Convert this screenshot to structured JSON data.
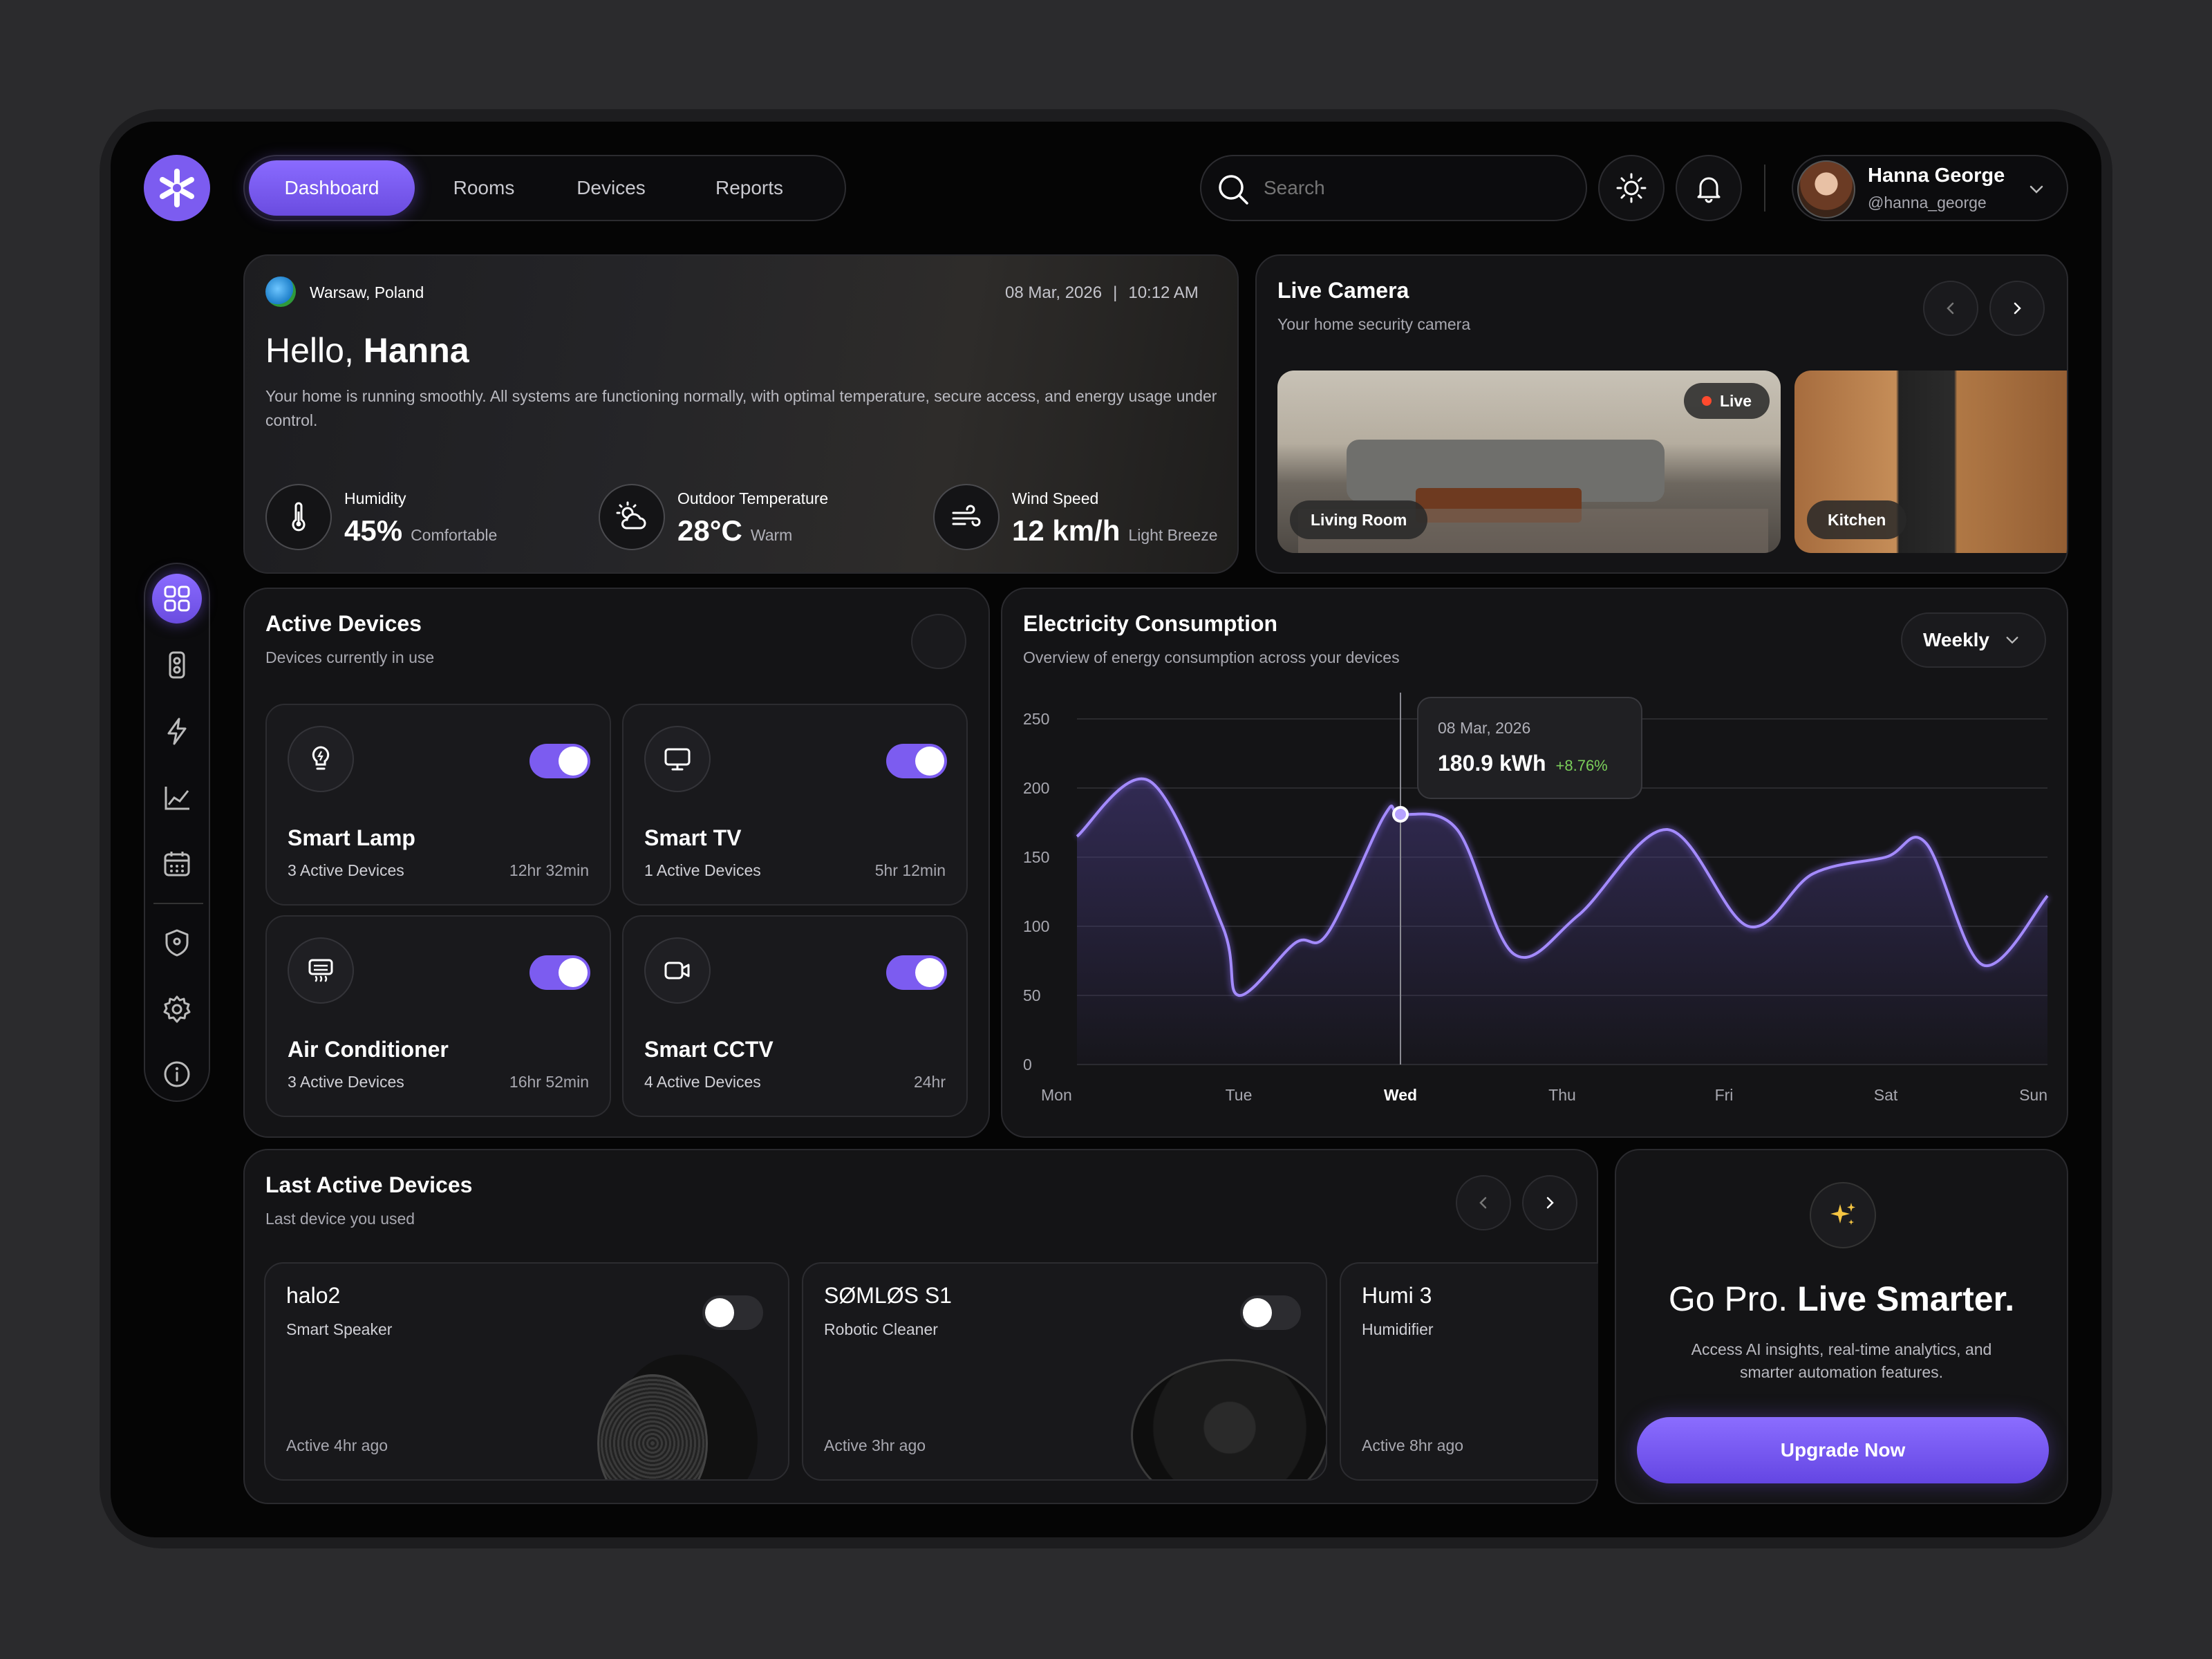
{
  "nav": {
    "tabs": [
      "Dashboard",
      "Rooms",
      "Devices",
      "Reports"
    ],
    "active": "Dashboard"
  },
  "search": {
    "placeholder": "Search"
  },
  "user": {
    "name": "Hanna George",
    "handle": "@hanna_george"
  },
  "hero": {
    "location": "Warsaw, Poland",
    "date": "08 Mar, 2026",
    "time": "10:12 AM",
    "greeting": "Hello,",
    "name": "Hanna",
    "description": "Your home is running smoothly. All systems are functioning normally, with optimal temperature, secure access, and energy usage under control.",
    "stats": [
      {
        "label": "Humidity",
        "value": "45%",
        "note": "Comfortable",
        "icon": "thermometer-icon"
      },
      {
        "label": "Outdoor Temperature",
        "value": "28°C",
        "note": "Warm",
        "icon": "sun-cloud-icon"
      },
      {
        "label": "Wind Speed",
        "value": "12 km/h",
        "note": "Light Breeze",
        "icon": "wind-icon"
      }
    ]
  },
  "camera": {
    "title": "Live Camera",
    "subtitle": "Your home security camera",
    "live_label": "Live",
    "rooms": [
      "Living Room",
      "Kitchen"
    ]
  },
  "active_devices": {
    "title": "Active Devices",
    "subtitle": "Devices currently in use",
    "devices": [
      {
        "name": "Smart Lamp",
        "count": "3 Active Devices",
        "time": "12hr 32min",
        "on": true,
        "icon": "lamp-icon"
      },
      {
        "name": "Smart TV",
        "count": "1 Active Devices",
        "time": "5hr 12min",
        "on": true,
        "icon": "tv-icon"
      },
      {
        "name": "Air Conditioner",
        "count": "3 Active Devices",
        "time": "16hr 52min",
        "on": true,
        "icon": "air-conditioner-icon"
      },
      {
        "name": "Smart CCTV",
        "count": "4 Active Devices",
        "time": "24hr",
        "on": true,
        "icon": "cctv-icon"
      }
    ]
  },
  "electricity": {
    "title": "Electricity Consumption",
    "subtitle": "Overview of energy consumption across your devices",
    "period": "Weekly",
    "tooltip": {
      "date": "08 Mar, 2026",
      "value": "180.9 kWh",
      "change": "+8.76%"
    }
  },
  "chart_data": {
    "type": "area",
    "title": "Electricity Consumption",
    "x": [
      "Mon",
      "Tue",
      "Wed",
      "Thu",
      "Fri",
      "Sat",
      "Sun"
    ],
    "highlight_x": "Wed",
    "yticks": [
      250,
      200,
      150,
      100,
      50,
      0
    ],
    "ylim": [
      0,
      250
    ],
    "grid": true,
    "series": [
      {
        "points": [
          [
            0,
            165
          ],
          [
            0.45,
            205
          ],
          [
            0.9,
            100
          ],
          [
            1.0,
            50
          ],
          [
            1.35,
            88
          ],
          [
            1.55,
            95
          ],
          [
            1.9,
            180
          ],
          [
            2.0,
            181
          ],
          [
            2.35,
            170
          ],
          [
            2.7,
            80
          ],
          [
            3.1,
            108
          ],
          [
            3.65,
            170
          ],
          [
            4.15,
            100
          ],
          [
            4.55,
            138
          ],
          [
            5.0,
            150
          ],
          [
            5.25,
            160
          ],
          [
            5.6,
            72
          ],
          [
            6.0,
            122
          ]
        ]
      }
    ],
    "colors": {
      "line": "#a48bff",
      "fill": "#3a2f6a"
    }
  },
  "last_active": {
    "title": "Last Active Devices",
    "subtitle": "Last device you used",
    "items": [
      {
        "name": "halo2",
        "type": "Smart Speaker",
        "status": "Active 4hr ago"
      },
      {
        "name": "SØMLØS S1",
        "type": "Robotic Cleaner",
        "status": "Active 3hr ago"
      },
      {
        "name": "Humi 3",
        "type": "Humidifier",
        "status": "Active 8hr ago"
      }
    ]
  },
  "promo": {
    "title_light": "Go Pro.",
    "title_bold": "Live Smarter.",
    "description": "Access AI insights, real-time analytics, and smarter automation features.",
    "cta": "Upgrade Now"
  }
}
